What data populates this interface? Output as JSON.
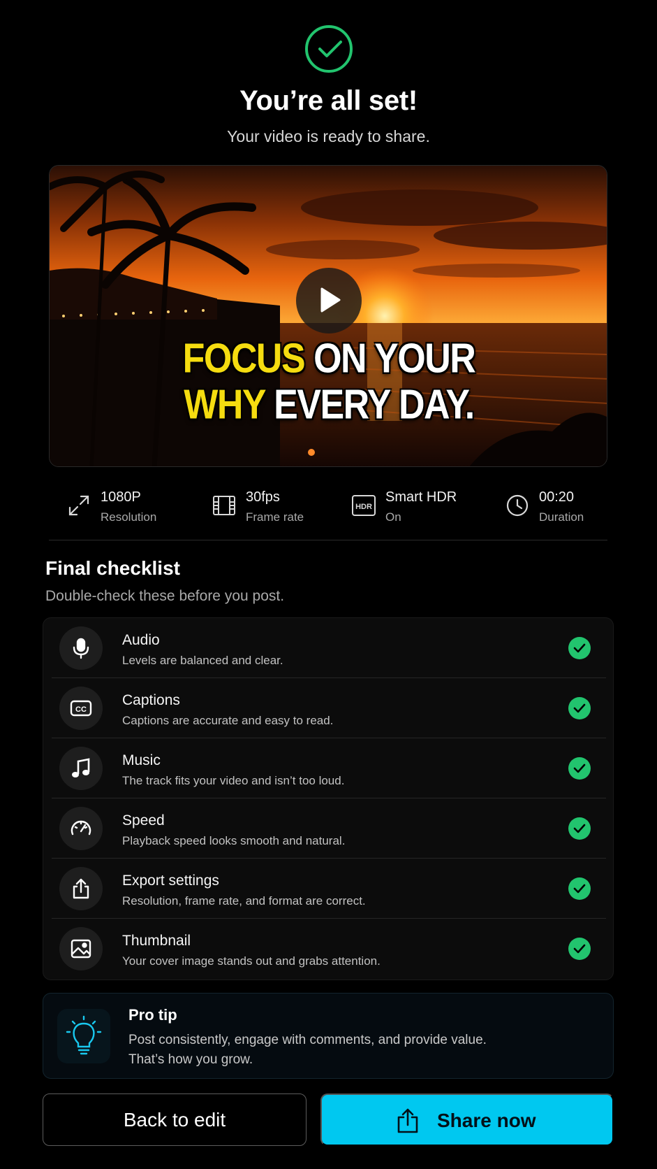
{
  "header": {
    "title": "You’re all set!",
    "subtitle": "Your video is ready to share."
  },
  "video": {
    "caption_line1_highlight": "FOCUS",
    "caption_line1_rest": "ON YOUR",
    "caption_line2_highlight": "WHY",
    "caption_line2_rest": "EVERY DAY.",
    "caption_highlight_color": "#f5dc10"
  },
  "specs": [
    {
      "icon": "expand-icon",
      "value": "1080P",
      "label": "Resolution"
    },
    {
      "icon": "film-icon",
      "value": "30fps",
      "label": "Frame rate"
    },
    {
      "icon": "hdr-icon",
      "value": "Smart HDR",
      "label": "On",
      "badge": "HDR"
    },
    {
      "icon": "clock-icon",
      "value": "00:20",
      "label": "Duration"
    }
  ],
  "checklist": {
    "title": "Final checklist",
    "subtitle": "Double-check these before you post.",
    "items": [
      {
        "icon": "microphone-icon",
        "title": "Audio",
        "desc": "Levels are balanced and clear.",
        "checked": true
      },
      {
        "icon": "captions-icon",
        "title": "Captions",
        "desc": "Captions are accurate and easy to read.",
        "checked": true
      },
      {
        "icon": "music-note-icon",
        "title": "Music",
        "desc": "The track fits your video and isn’t too loud.",
        "checked": true
      },
      {
        "icon": "speedometer-icon",
        "title": "Speed",
        "desc": "Playback speed looks smooth and natural.",
        "checked": true
      },
      {
        "icon": "export-icon",
        "title": "Export settings",
        "desc": "Resolution, frame rate, and format are correct.",
        "checked": true
      },
      {
        "icon": "image-icon",
        "title": "Thumbnail",
        "desc": "Your cover image stands out and grabs attention.",
        "checked": true
      }
    ]
  },
  "tip": {
    "title": "Pro tip",
    "text": "Post consistently, engage with comments, and provide value.\nThat’s how you grow."
  },
  "actions": {
    "back_label": "Back to edit",
    "share_label": "Share now"
  },
  "colors": {
    "success": "#22c46e",
    "accent": "#00c8f0",
    "background": "#000000"
  }
}
